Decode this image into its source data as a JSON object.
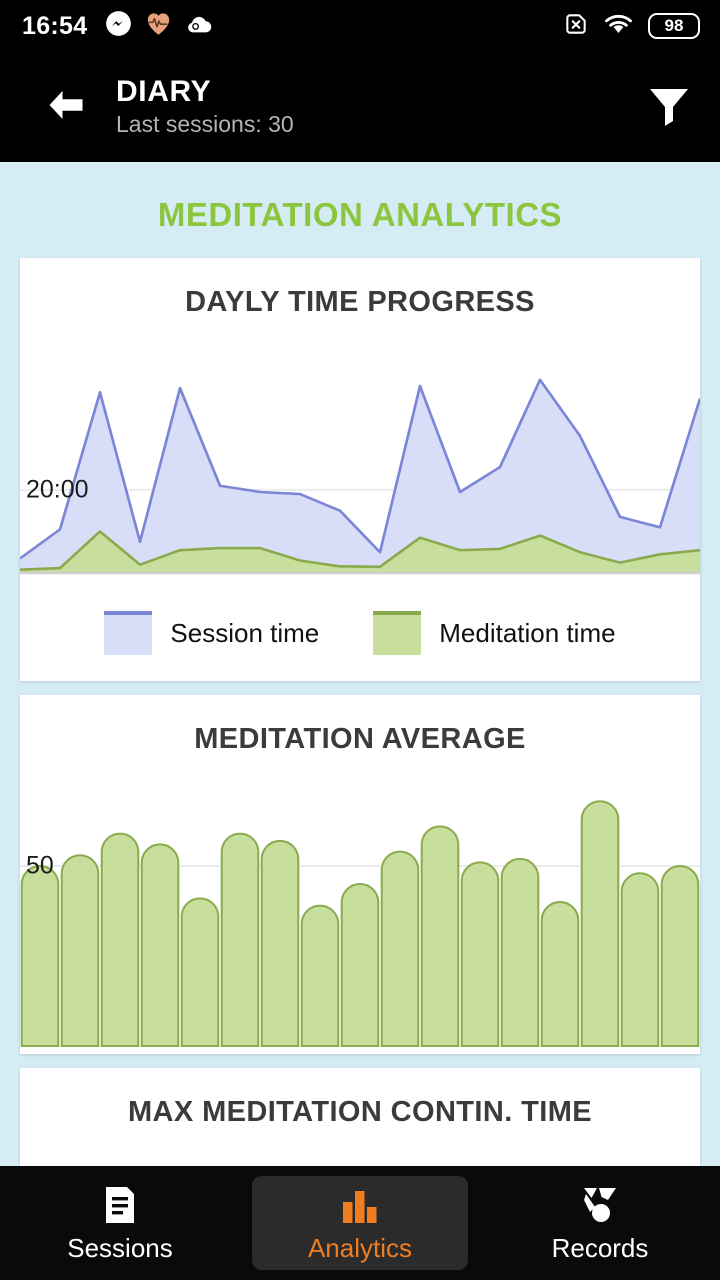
{
  "statusbar": {
    "clock": "16:54",
    "left_icons": [
      "messenger-icon",
      "heart-health-icon",
      "cloud-icon"
    ],
    "right_icons": [
      "no-sim-icon",
      "wifi-icon"
    ],
    "battery_level": "98"
  },
  "appbar": {
    "back_icon": "back-arrow-icon",
    "title": "DIARY",
    "subtitle": "Last sessions: 30",
    "filter_icon": "filter-funnel-icon"
  },
  "page": {
    "section_title": "MEDITATION ANALYTICS",
    "background_color": "#d5ecf5",
    "accent_green": "#8cc63f",
    "accent_orange": "#f07d20"
  },
  "cards": [
    {
      "title": "DAYLY TIME PROGRESS",
      "axis_label": "20:00",
      "legend": [
        {
          "label": "Session time",
          "fill": "#d9def8",
          "stroke": "#7b86d6"
        },
        {
          "label": "Meditation time",
          "fill": "#c7de9d",
          "stroke": "#8aab4d"
        }
      ]
    },
    {
      "title": "MEDITATION AVERAGE",
      "axis_label": "50"
    },
    {
      "title": "MAX MEDITATION CONTIN. TIME"
    }
  ],
  "bottomnav": {
    "items": [
      {
        "label": "Sessions",
        "icon": "document-list-icon",
        "active": false
      },
      {
        "label": "Analytics",
        "icon": "bar-chart-icon",
        "active": true
      },
      {
        "label": "Records",
        "icon": "medal-award-icon",
        "active": false
      }
    ]
  },
  "chart_data": [
    {
      "type": "area",
      "title": "DAYLY TIME PROGRESS",
      "xlabel": "",
      "ylabel": "",
      "grid": true,
      "gridlines": [
        20
      ],
      "ytick_labels": [
        "20:00"
      ],
      "ylim": [
        0,
        52
      ],
      "legend_position": "bottom",
      "x": [
        0,
        1,
        2,
        3,
        4,
        5,
        6,
        7,
        8,
        9,
        10,
        11,
        12,
        13,
        14,
        15,
        16,
        17,
        18,
        19,
        20,
        21,
        22,
        23,
        24,
        25,
        26,
        27,
        28,
        29
      ],
      "series": [
        {
          "name": "Session time",
          "fill": "#d9def8",
          "stroke": "#7b86d6",
          "values": [
            3.5,
            10.5,
            43.5,
            7.5,
            44.5,
            21.0,
            19.5,
            19.0,
            15.0,
            5.0,
            45.0,
            19.5,
            25.5,
            46.5,
            33.0,
            13.5,
            11.0,
            42.0
          ]
        },
        {
          "name": "Meditation time",
          "fill": "#c7de9d",
          "stroke": "#8aab4d",
          "values": [
            0.8,
            1.2,
            10.0,
            2.0,
            5.5,
            6.0,
            6.0,
            3.0,
            1.6,
            1.5,
            8.5,
            5.5,
            5.8,
            9.0,
            5.0,
            2.5,
            4.5,
            5.5
          ]
        }
      ]
    },
    {
      "type": "bar",
      "title": "MEDITATION AVERAGE",
      "xlabel": "",
      "ylabel": "",
      "grid": true,
      "gridlines": [
        50
      ],
      "ytick_labels": [
        "50"
      ],
      "ylim": [
        0,
        75
      ],
      "categories": [
        "1",
        "2",
        "3",
        "4",
        "5",
        "6",
        "7",
        "8",
        "9",
        "10",
        "11",
        "12",
        "13",
        "14",
        "15",
        "16",
        "17"
      ],
      "values": [
        50,
        53,
        59,
        56,
        41,
        59,
        57,
        39,
        45,
        54,
        61,
        51,
        52,
        40,
        68,
        48,
        50
      ],
      "bar_fill": "#c7de9d",
      "bar_stroke": "#8aab4d"
    }
  ]
}
